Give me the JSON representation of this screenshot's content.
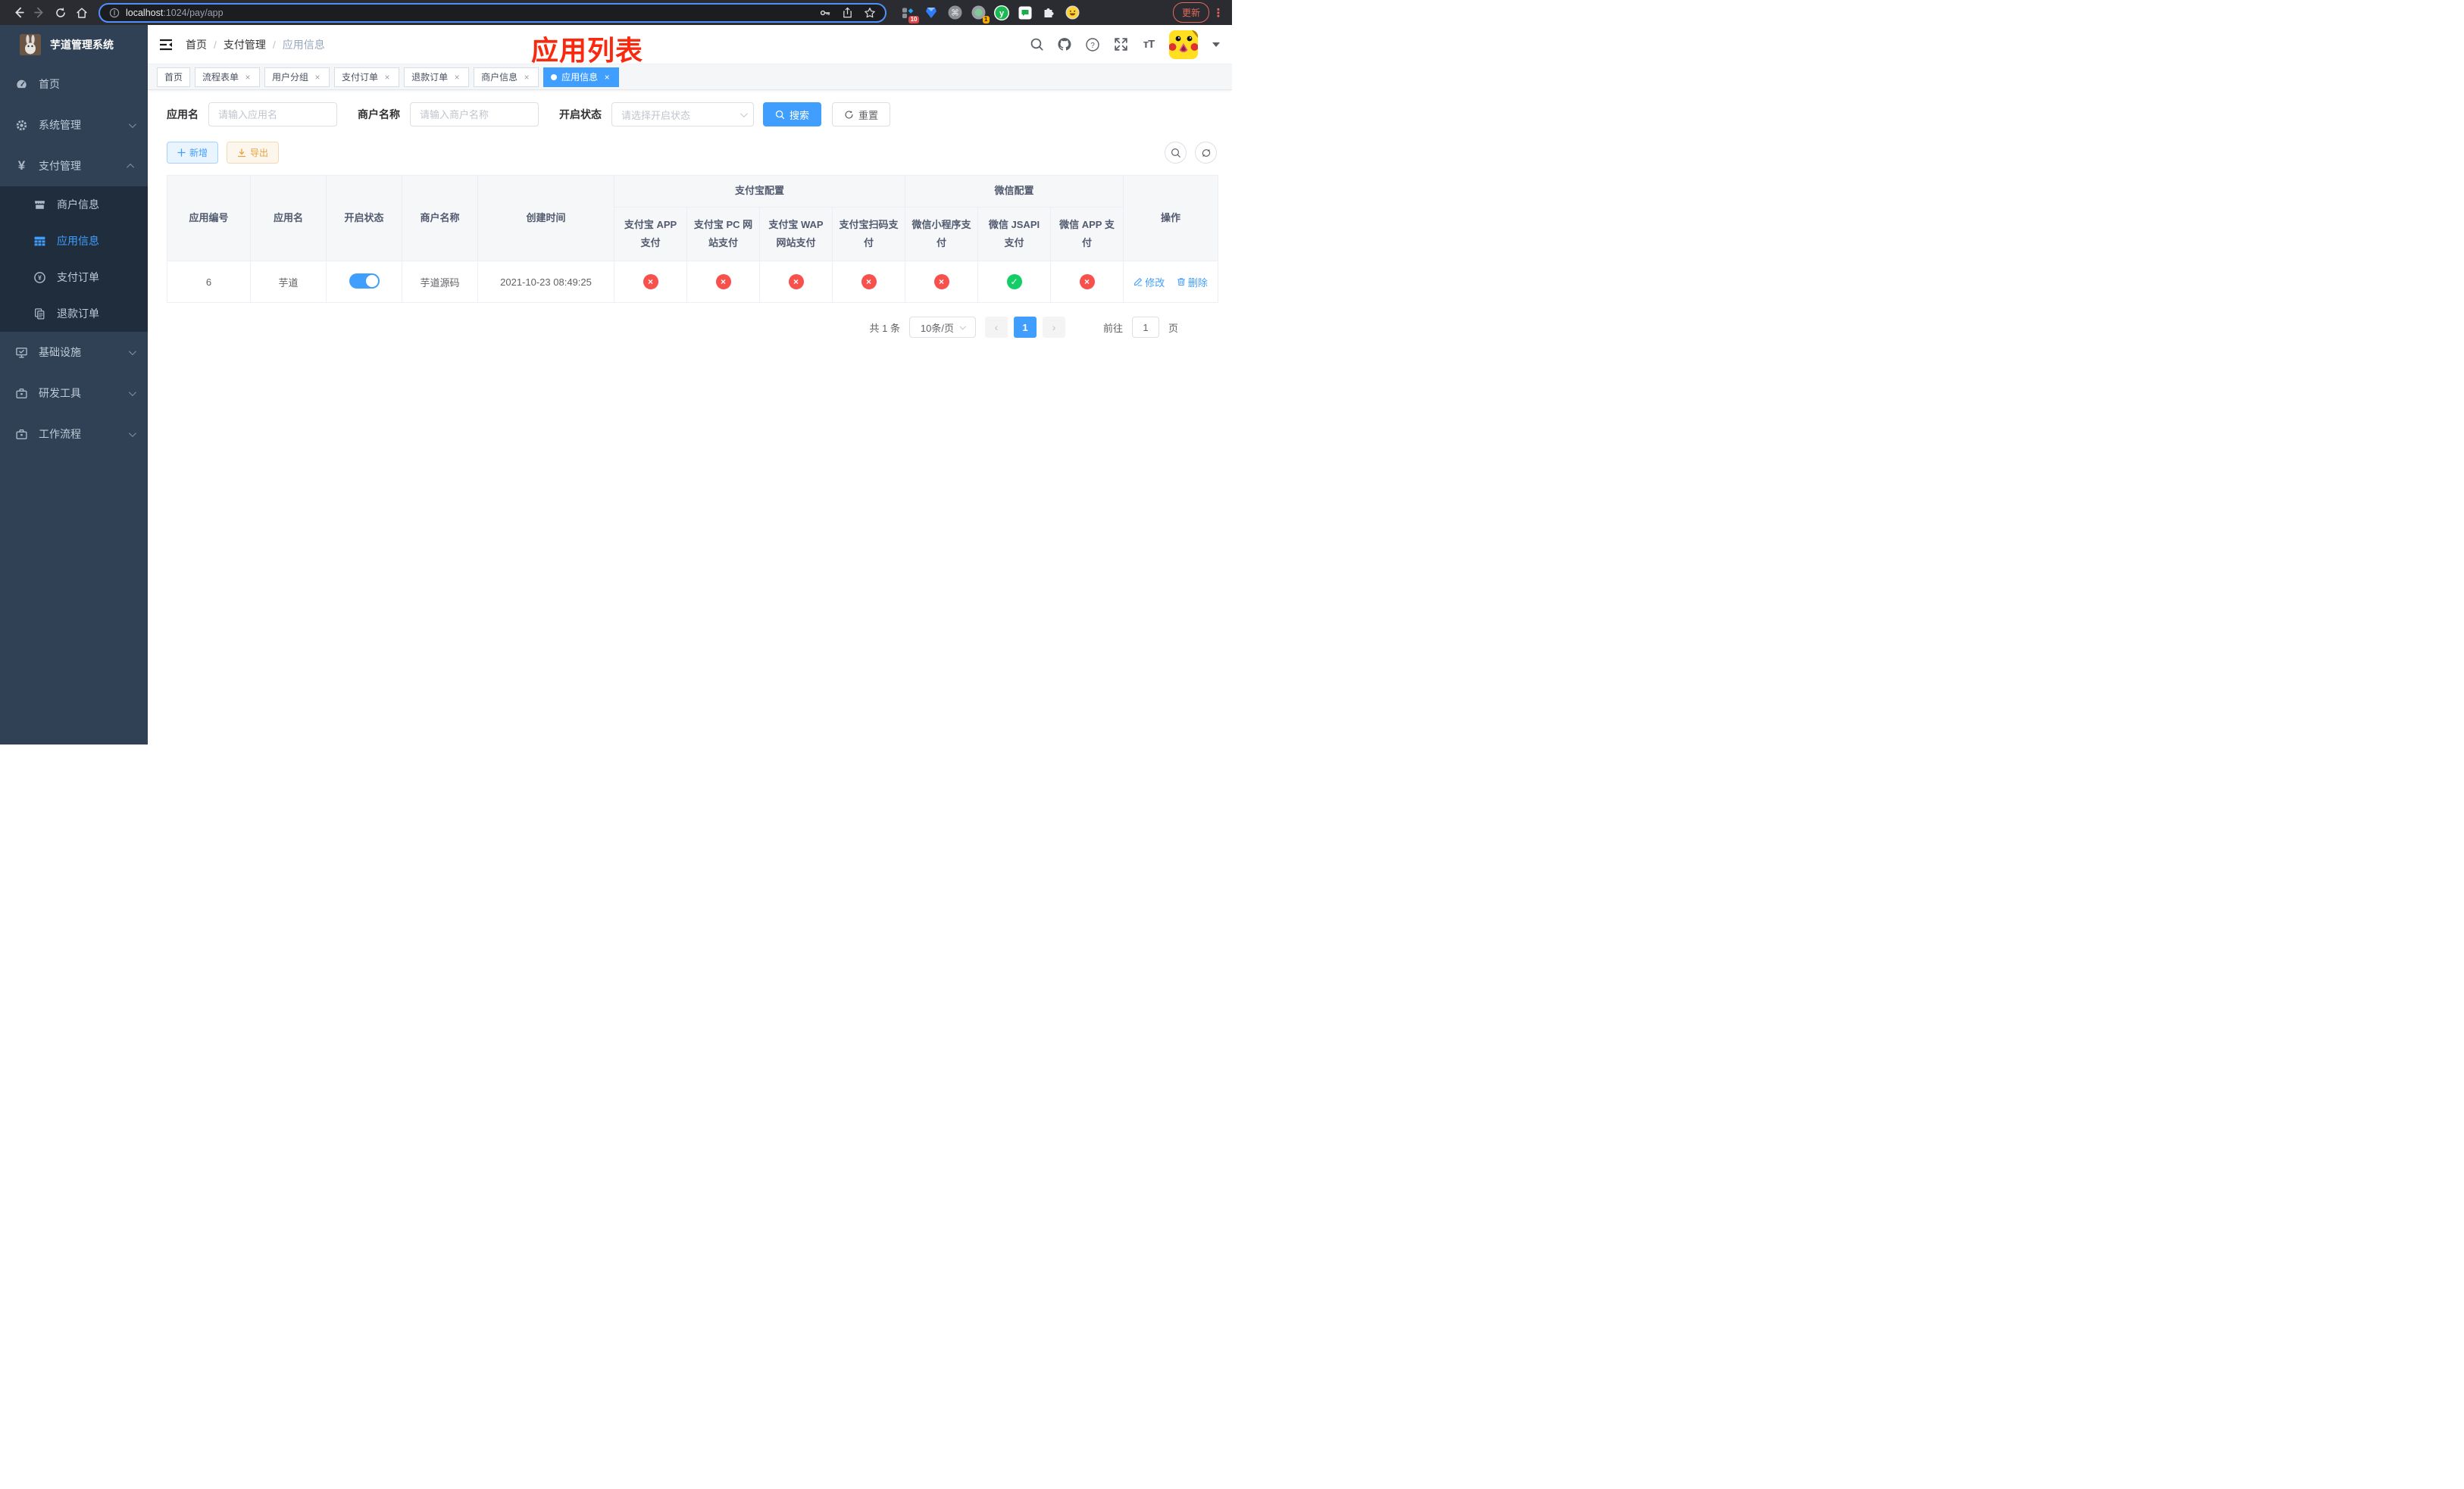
{
  "browser": {
    "url_host": "localhost",
    "url_rest": ":1024/pay/app",
    "update_label": "更新",
    "ext_badge_grid": "10",
    "ext_badge_record": "1"
  },
  "sidebar": {
    "title": "芋道管理系统",
    "items": [
      {
        "label": "首页"
      },
      {
        "label": "系统管理"
      },
      {
        "label": "支付管理"
      },
      {
        "label": "商户信息"
      },
      {
        "label": "应用信息"
      },
      {
        "label": "支付订单"
      },
      {
        "label": "退款订单"
      },
      {
        "label": "基础设施"
      },
      {
        "label": "研发工具"
      },
      {
        "label": "工作流程"
      }
    ]
  },
  "header": {
    "breadcrumb": [
      "首页",
      "支付管理",
      "应用信息"
    ],
    "annotation": "应用列表"
  },
  "tabs": [
    {
      "label": "首页"
    },
    {
      "label": "流程表单"
    },
    {
      "label": "用户分组"
    },
    {
      "label": "支付订单"
    },
    {
      "label": "退款订单"
    },
    {
      "label": "商户信息"
    },
    {
      "label": "应用信息"
    }
  ],
  "filters": {
    "app_name_label": "应用名",
    "app_name_placeholder": "请输入应用名",
    "merchant_label": "商户名称",
    "merchant_placeholder": "请输入商户名称",
    "status_label": "开启状态",
    "status_placeholder": "请选择开启状态",
    "search_label": "搜索",
    "reset_label": "重置"
  },
  "toolbar": {
    "add_label": "新增",
    "export_label": "导出"
  },
  "table": {
    "main_cols": [
      "应用编号",
      "应用名",
      "开启状态",
      "商户名称",
      "创建时间"
    ],
    "alipay_group": "支付宝配置",
    "wechat_group": "微信配置",
    "pay_cols": [
      "支付宝 APP 支付",
      "支付宝 PC 网站支付",
      "支付宝 WAP 网站支付",
      "支付宝扫码支付",
      "微信小程序支付",
      "微信 JSAPI 支付",
      "微信 APP 支付"
    ],
    "op_col": "操作",
    "rows": [
      {
        "id": "6",
        "name": "芋道",
        "enabled": true,
        "merchant": "芋道源码",
        "created": "2021-10-23 08:49:25",
        "statuses": [
          "no",
          "no",
          "no",
          "no",
          "no",
          "yes",
          "no"
        ],
        "edit_label": "修改",
        "delete_label": "删除"
      }
    ]
  },
  "pagination": {
    "total": "共 1 条",
    "page_size": "10条/页",
    "current_page": "1",
    "goto_label": "前往",
    "goto_value": "1",
    "page_suffix": "页"
  },
  "colors": {
    "primary": "#409eff",
    "success": "#13ce66",
    "danger": "#f8514c",
    "warning": "#e6a23c",
    "sidebar_bg": "#304156",
    "submenu_bg": "#1f2d3d",
    "annotation_red": "#f8290e"
  }
}
